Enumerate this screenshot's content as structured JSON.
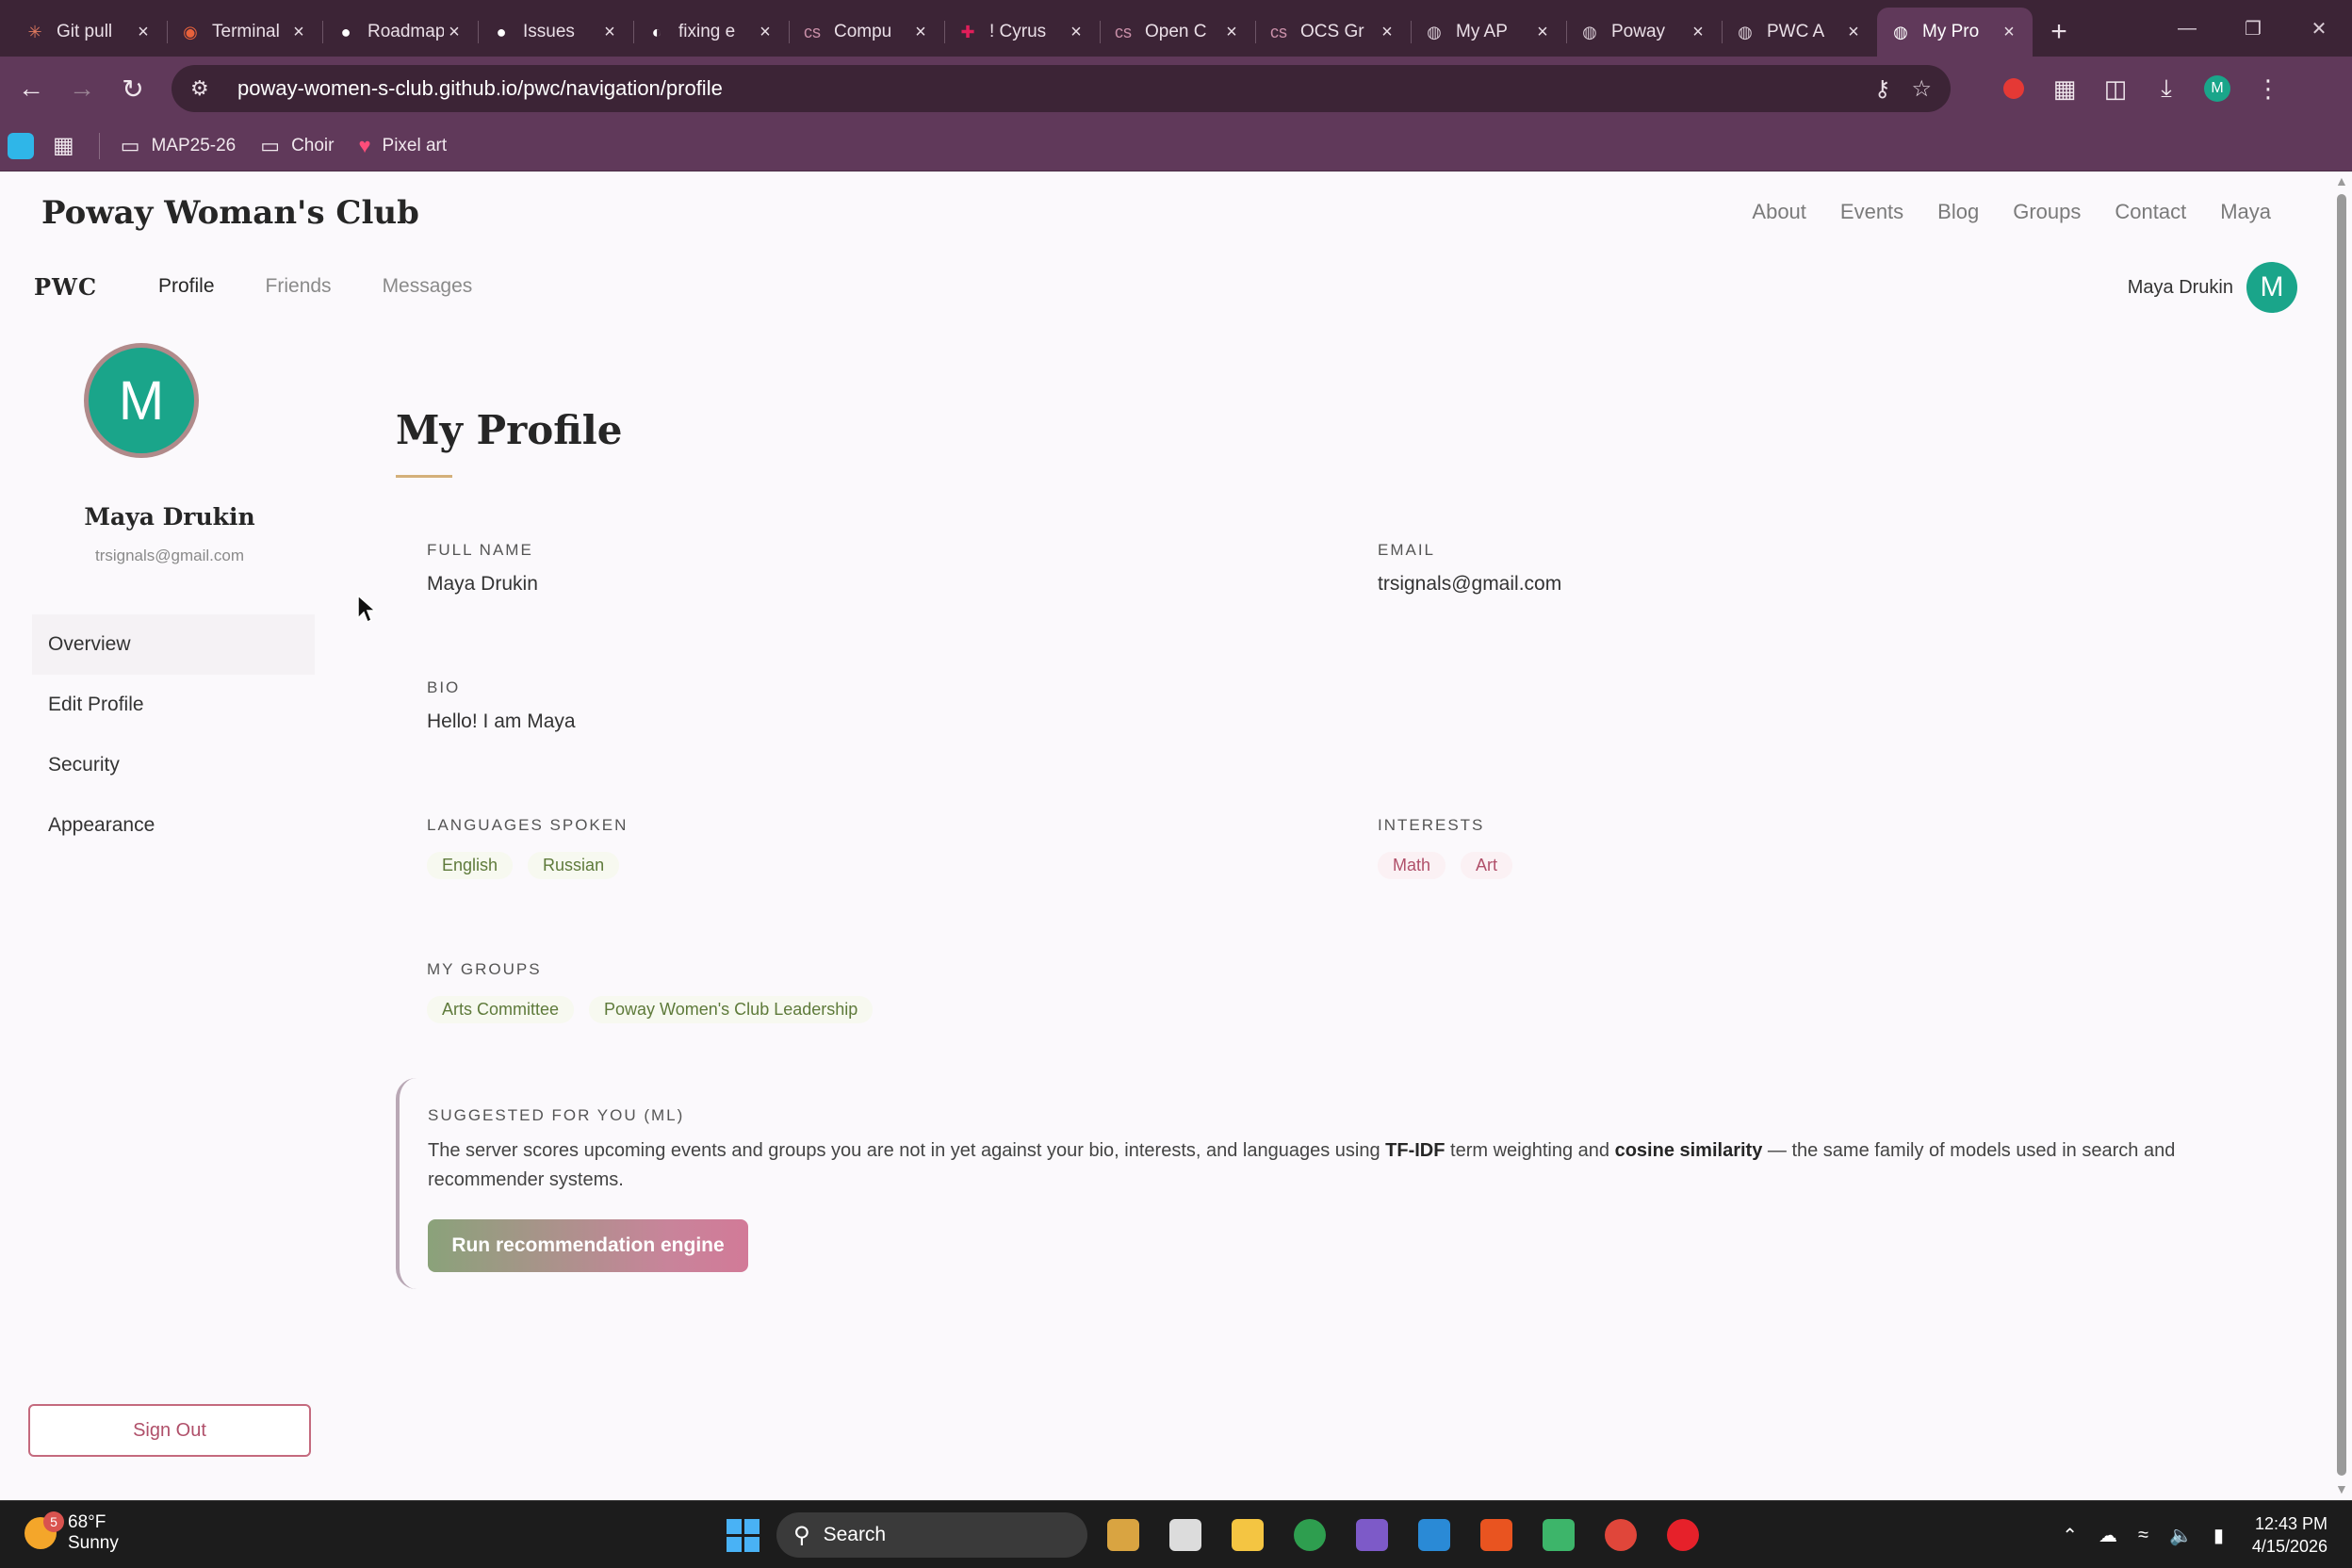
{
  "browser": {
    "tabs": [
      {
        "title": "Git pull",
        "favicon": "claude-icon",
        "color": "#e07a5f",
        "glyph": "✳"
      },
      {
        "title": "Terminal",
        "favicon": "gitlab-icon",
        "color": "#e8623c",
        "glyph": "◉"
      },
      {
        "title": "Roadmap",
        "favicon": "github-icon",
        "color": "#ffffff",
        "glyph": "●"
      },
      {
        "title": "Issues",
        "favicon": "github-icon",
        "color": "#ffffff",
        "glyph": "●"
      },
      {
        "title": "fixing e",
        "favicon": "copilot-icon",
        "color": "#ffffff",
        "glyph": "◐"
      },
      {
        "title": "Compu",
        "favicon": "cs-icon",
        "color": "#c98fa8",
        "glyph": "cs"
      },
      {
        "title": "! Cyrus",
        "favicon": "slack-icon",
        "color": "#e01e5a",
        "glyph": "✚"
      },
      {
        "title": "Open C",
        "favicon": "cs-icon",
        "color": "#c98fa8",
        "glyph": "cs"
      },
      {
        "title": "OCS Gr",
        "favicon": "cs-icon",
        "color": "#c98fa8",
        "glyph": "cs"
      },
      {
        "title": "My AP",
        "favicon": "globe-icon",
        "color": "#d8cbd4",
        "glyph": "◍"
      },
      {
        "title": "Poway",
        "favicon": "globe-icon",
        "color": "#d8cbd4",
        "glyph": "◍"
      },
      {
        "title": "PWC A",
        "favicon": "globe-icon",
        "color": "#d8cbd4",
        "glyph": "◍"
      },
      {
        "title": "My Pro",
        "favicon": "globe-icon",
        "color": "#ffffff",
        "glyph": "◍",
        "active": true
      }
    ],
    "url": "poway-women-s-club.github.io/pwc/navigation/profile",
    "bookmarks": [
      {
        "label": "MAP25-26",
        "icon": "folder-icon"
      },
      {
        "label": "Choir",
        "icon": "folder-icon"
      },
      {
        "label": "Pixel art",
        "icon": "heart-icon"
      }
    ],
    "profile_initial": "M"
  },
  "site": {
    "title": "Poway Woman's Club",
    "nav": [
      "About",
      "Events",
      "Blog",
      "Groups",
      "Contact",
      "Maya"
    ],
    "brand": "PWC",
    "subnav": [
      {
        "label": "Profile",
        "active": true
      },
      {
        "label": "Friends",
        "active": false
      },
      {
        "label": "Messages",
        "active": false
      }
    ],
    "user_name": "Maya Drukin",
    "user_initial": "M"
  },
  "sidebar": {
    "initial": "M",
    "name": "Maya Drukin",
    "email": "trsignals@gmail.com",
    "menu": [
      {
        "label": "Overview",
        "active": true
      },
      {
        "label": "Edit Profile",
        "active": false
      },
      {
        "label": "Security",
        "active": false
      },
      {
        "label": "Appearance",
        "active": false
      }
    ],
    "signout": "Sign Out"
  },
  "profile": {
    "title": "My Profile",
    "full_name_label": "FULL NAME",
    "full_name": "Maya Drukin",
    "email_label": "EMAIL",
    "email": "trsignals@gmail.com",
    "bio_label": "BIO",
    "bio": "Hello! I am Maya",
    "languages_label": "LANGUAGES SPOKEN",
    "languages": [
      "English",
      "Russian"
    ],
    "interests_label": "INTERESTS",
    "interests": [
      "Math",
      "Art"
    ],
    "groups_label": "MY GROUPS",
    "groups": [
      "Arts Committee",
      "Poway Women's Club Leadership"
    ]
  },
  "suggest": {
    "label": "SUGGESTED FOR YOU (ML)",
    "text_1": "The server scores upcoming events and groups you are not in yet against your bio, interests, and languages using ",
    "bold_1": "TF-IDF",
    "text_2": " term weighting and ",
    "bold_2": "cosine similarity",
    "text_3": " — the same family of models used in search and recommender systems.",
    "button": "Run recommendation engine"
  },
  "taskbar": {
    "temp": "68°F",
    "condition": "Sunny",
    "weather_badge": "5",
    "search": "Search",
    "time": "12:43 PM",
    "date": "4/15/2026",
    "apps": [
      {
        "name": "widgets-icon",
        "color": "#d9a441"
      },
      {
        "name": "task-view-icon",
        "color": "#dcdcdc"
      },
      {
        "name": "file-explorer-icon",
        "color": "#f4c542"
      },
      {
        "name": "chrome-icon",
        "color": "#2e9e4f"
      },
      {
        "name": "m365-icon",
        "color": "#7d5ac8"
      },
      {
        "name": "vscode-icon",
        "color": "#2a8ad6"
      },
      {
        "name": "ubuntu-icon",
        "color": "#e95420"
      },
      {
        "name": "git-icon",
        "color": "#3db56a"
      },
      {
        "name": "chrome-profile-icon",
        "color": "#e0463a"
      },
      {
        "name": "record-icon",
        "color": "#e6212a"
      }
    ]
  }
}
